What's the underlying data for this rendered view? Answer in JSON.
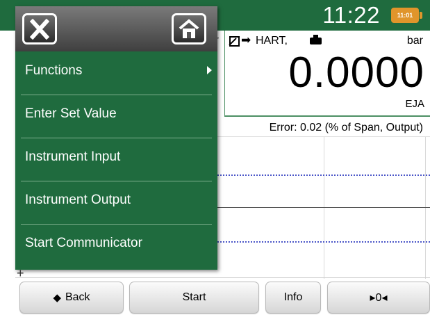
{
  "status": {
    "time": "11:22",
    "battery_text": "11:01",
    "battery_color": "#e0952b",
    "bar_color": "#1f6b3e"
  },
  "measurement": {
    "hidden_prefix": "r",
    "protocol": "HART,",
    "unit": "bar",
    "value": "0.0000",
    "device": "EJA",
    "error_label": "Error: 0.02 (% of Span, Output)"
  },
  "icons": {
    "close": "close-icon",
    "home": "home-icon",
    "hart": "hart-arrow-icon",
    "device": "device-icon",
    "back": "back-arrow-icon",
    "submenu": "chevron-right-icon"
  },
  "menu": {
    "items": [
      {
        "label": "Functions",
        "has_submenu": true
      },
      {
        "label": "Enter Set Value"
      },
      {
        "label": "Instrument Input"
      },
      {
        "label": "Instrument Output"
      },
      {
        "label": "Start Communicator"
      }
    ]
  },
  "toolbar": {
    "back_arrow": "◆",
    "back": "Back",
    "start": "Start",
    "info": "Info",
    "zero": "▸0◂"
  },
  "graph": {
    "axis_tick": "+"
  }
}
